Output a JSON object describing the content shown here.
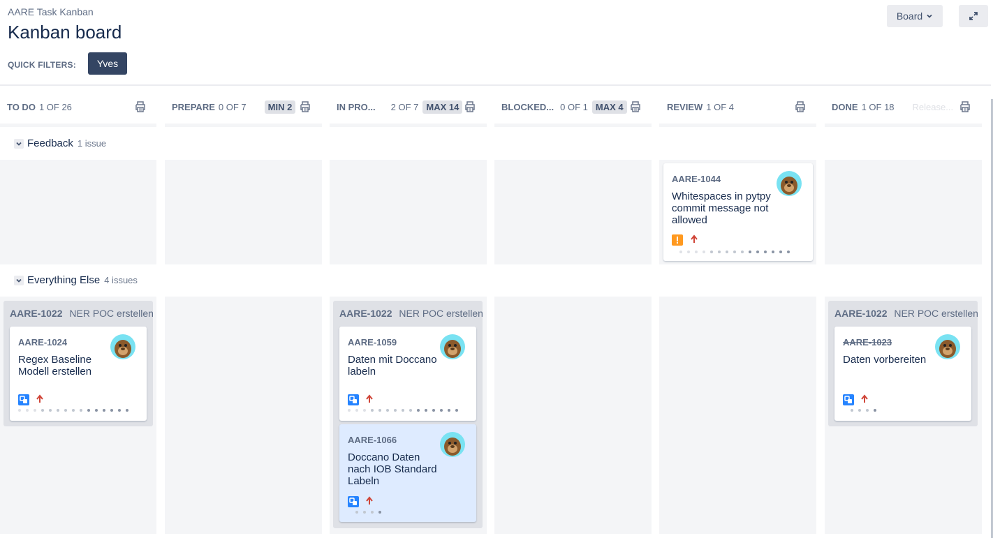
{
  "header": {
    "project_name": "AARE Task Kanban",
    "page_title": "Kanban board",
    "quick_filters_label": "QUICK FILTERS:",
    "quick_filters": [
      "Yves"
    ],
    "board_button_label": "Board",
    "expand_icon": "expand-diagonal-icon"
  },
  "columns": [
    {
      "name": "TO DO",
      "count": "1 OF 26",
      "constraint": ""
    },
    {
      "name": "PREPARE",
      "count": "0 OF 7",
      "constraint": "MIN 2"
    },
    {
      "name": "IN PRO...",
      "count": "2 OF 7",
      "constraint": "MAX 14"
    },
    {
      "name": "BLOCKED...",
      "count": "0 OF 1",
      "constraint": "MAX 4"
    },
    {
      "name": "REVIEW",
      "count": "1 OF 4",
      "constraint": ""
    },
    {
      "name": "DONE",
      "count": "1 OF 18",
      "constraint": "",
      "release_label": "Release..."
    }
  ],
  "swimlanes": [
    {
      "name": "Feedback",
      "count": "1 issue"
    },
    {
      "name": "Everything Else",
      "count": "4 issues"
    }
  ],
  "parent": {
    "key": "AARE-1022",
    "summary": "NER POC erstellen"
  },
  "cards": {
    "aare_1044": {
      "key": "AARE-1044",
      "summary": "Whitespaces in pytpy commit message not allowed",
      "type": "bug-icon",
      "priority": "priority-high-icon"
    },
    "aare_1024": {
      "key": "AARE-1024",
      "summary": "Regex Baseline Modell erstellen",
      "type": "subtask-icon",
      "priority": "priority-high-icon"
    },
    "aare_1059": {
      "key": "AARE-1059",
      "summary": "Daten mit Doccano labeln",
      "type": "subtask-icon",
      "priority": "priority-high-icon"
    },
    "aare_1066": {
      "key": "AARE-1066",
      "summary": "Doccano Daten nach IOB Standard Labeln",
      "type": "subtask-icon",
      "priority": "priority-high-icon"
    },
    "aare_1023": {
      "key": "AARE-1023",
      "summary": "Daten vorbereiten",
      "type": "subtask-icon",
      "priority": "priority-high-icon",
      "done": true
    }
  },
  "colors": {
    "quick_filter_active": "#344563",
    "bug": "#ff991f",
    "subtask": "#2684ff",
    "priority_high": "#d04437",
    "cell_bg": "#f4f5f7",
    "selected_card": "#deebff"
  }
}
